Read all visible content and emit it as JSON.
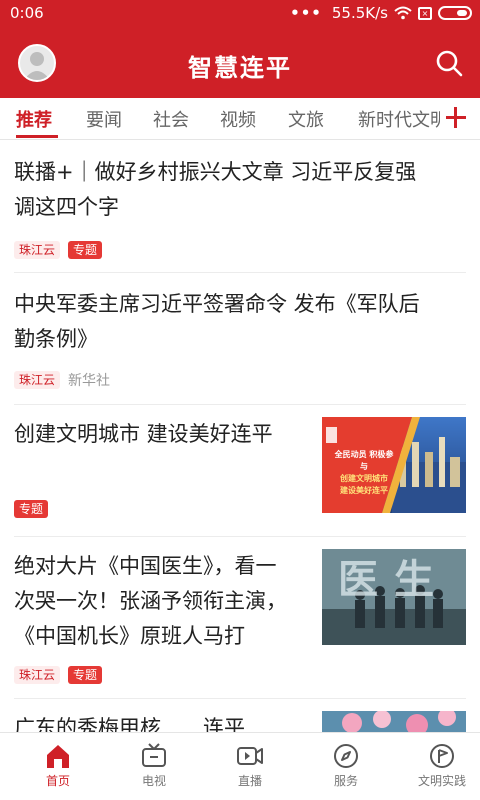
{
  "status_bar": {
    "time": "0:06",
    "network_speed": "55.5K/s",
    "signal_dots": "•••"
  },
  "header": {
    "title": "智慧连平",
    "avatar_icon": "user-avatar",
    "search_icon": "search-icon"
  },
  "tabs": {
    "items": [
      {
        "label": "推荐",
        "active": true
      },
      {
        "label": "要闻"
      },
      {
        "label": "社会"
      },
      {
        "label": "视频"
      },
      {
        "label": "文旅"
      },
      {
        "label": "新时代文明"
      }
    ],
    "add_icon": "plus-icon"
  },
  "feed": {
    "items": [
      {
        "title_line1": "联播+｜做好乡村振兴大文章 习近平反复强",
        "title_line2": "调这四个字",
        "tags": [
          "珠江云",
          "专题"
        ]
      },
      {
        "title_line1": "中央军委主席习近平签署命令 发布《军队后",
        "title_line2": "勤条例》",
        "tags": [
          "珠江云"
        ],
        "source": "新华社"
      },
      {
        "title_line1": "创建文明城市 建设美好连平",
        "tags": [
          "专题"
        ],
        "thumb_text": [
          "全民动员 积极参与",
          "创建文明城市",
          "建设美好连平"
        ]
      },
      {
        "title_line1": "绝对大片《中国医生》，看一",
        "title_line2": "次哭一次！张涵予领衔主演，",
        "title_line3": "《中国机长》原班人马打",
        "tags": [
          "珠江云",
          "专题"
        ],
        "thumb_text": "医生"
      },
      {
        "title_line1": "广东的秀梅甲核……连平"
      }
    ]
  },
  "bottom_nav": {
    "items": [
      {
        "label": "首页",
        "icon": "home-icon",
        "active": true
      },
      {
        "label": "电视",
        "icon": "tv-icon"
      },
      {
        "label": "直播",
        "icon": "live-video-icon"
      },
      {
        "label": "服务",
        "icon": "compass-icon"
      },
      {
        "label": "文明实践",
        "icon": "flag-icon"
      }
    ]
  },
  "colors": {
    "brand_red": "#cf2027",
    "tag_red": "#e53935",
    "text": "#222222",
    "muted": "#999999"
  }
}
